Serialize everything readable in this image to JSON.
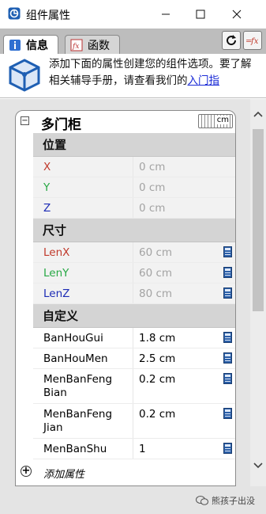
{
  "window": {
    "title": "组件属性",
    "buttons": {
      "minimize": "–",
      "maximize": "☐",
      "close": "✕"
    }
  },
  "tabs": [
    {
      "label": "信息",
      "icon": "info-icon",
      "active": true
    },
    {
      "label": "函数",
      "icon": "function-icon",
      "active": false
    }
  ],
  "toolbar": {
    "refresh_icon": "refresh-icon",
    "fx_icon": "fx-remove-icon"
  },
  "banner": {
    "text": "添加下面的属性创建您的组件选项。要了解相关辅导手册，请查看我们的",
    "link": "入门指"
  },
  "component": {
    "name": "多门柜",
    "unit": "cm"
  },
  "sections": {
    "position": {
      "title": "位置",
      "rows": [
        {
          "name": "X",
          "value": "0 cm",
          "color": "#c0392b"
        },
        {
          "name": "Y",
          "value": "0 cm",
          "color": "#27a844"
        },
        {
          "name": "Z",
          "value": "0 cm",
          "color": "#1c2bb5"
        }
      ]
    },
    "size": {
      "title": "尺寸",
      "rows": [
        {
          "name": "LenX",
          "value": "60 cm",
          "color": "#c0392b"
        },
        {
          "name": "LenY",
          "value": "60 cm",
          "color": "#27a844"
        },
        {
          "name": "LenZ",
          "value": "80 cm",
          "color": "#1c2bb5"
        }
      ]
    },
    "custom": {
      "title": "自定义",
      "rows": [
        {
          "name": "BanHouGui",
          "value": "1.8 cm"
        },
        {
          "name": "BanHouMen",
          "value": "2.5 cm"
        },
        {
          "name": "MenBanFeng Bian",
          "value": "0.2 cm"
        },
        {
          "name": "MenBanFeng Jian",
          "value": "0.2 cm"
        },
        {
          "name": "MenBanShu",
          "value": "1"
        }
      ]
    }
  },
  "add_attribute": {
    "label": "添加属性"
  },
  "footer": {
    "watermark": "熊孩子出没"
  },
  "colors": {
    "red": "#c0392b",
    "green": "#27a844",
    "blue": "#1c2bb5",
    "section_bg": "#d4d4d4",
    "link": "#1a2bd6"
  }
}
